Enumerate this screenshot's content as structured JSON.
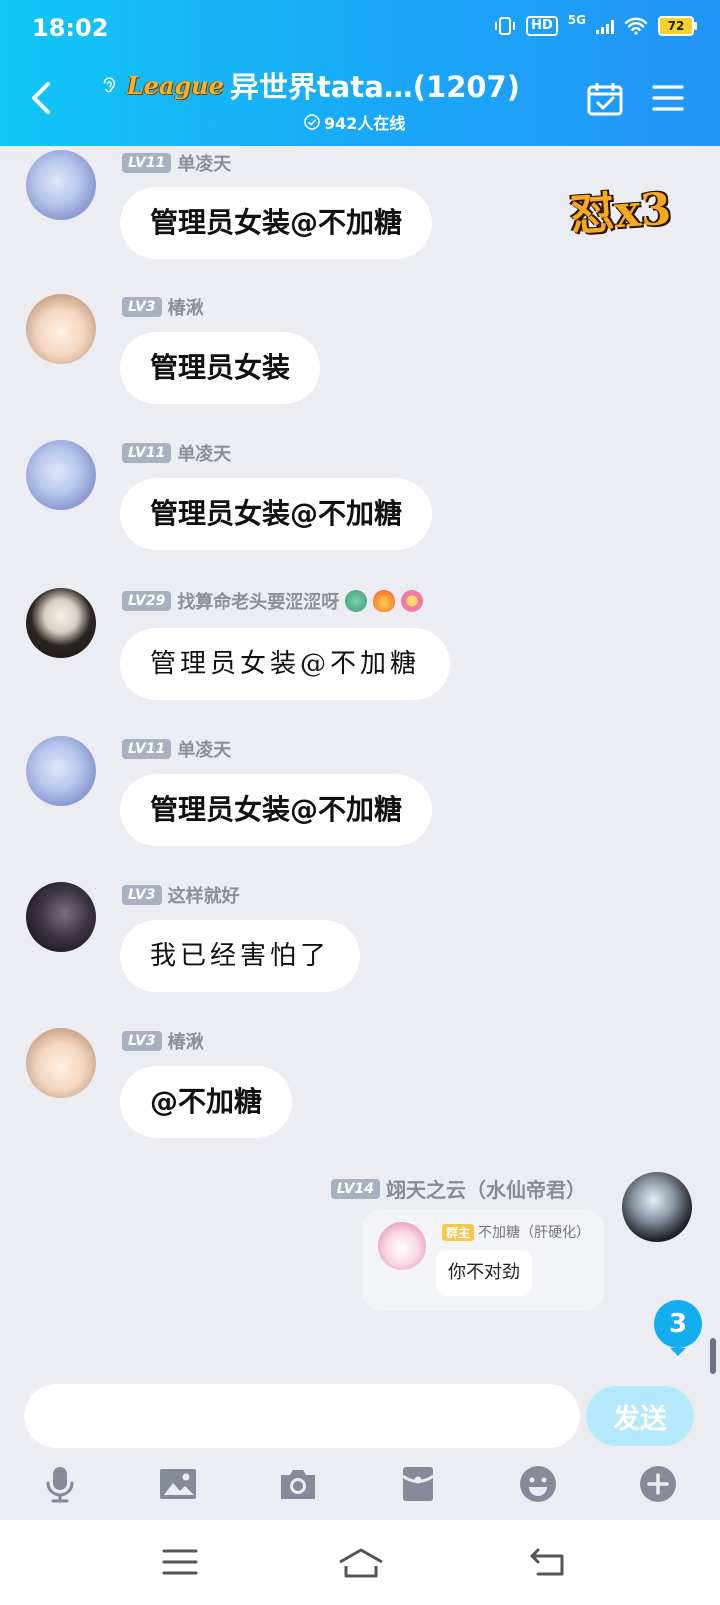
{
  "status": {
    "time": "18:02",
    "network": "5G",
    "hd": "HD",
    "battery": "72"
  },
  "header": {
    "logo": "League",
    "title": "异世界tata…(1207)",
    "online": "942人在线"
  },
  "messages": [
    {
      "level": "LV11",
      "name": "单凌天",
      "text": "管理员女装@不加糖",
      "sticker": "怼x3"
    },
    {
      "level": "LV3",
      "name": "椿湫",
      "text": "管理员女装"
    },
    {
      "level": "LV11",
      "name": "单凌天",
      "text": "管理员女装@不加糖"
    },
    {
      "level": "LV29",
      "name": "找算命老头要涩涩呀",
      "text": "管理员女装@不加糖"
    },
    {
      "level": "LV11",
      "name": "单凌天",
      "text": "管理员女装@不加糖"
    },
    {
      "level": "LV3",
      "name": "这样就好",
      "text": "我已经害怕了"
    },
    {
      "level": "LV3",
      "name": "椿湫",
      "text": "@不加糖"
    }
  ],
  "self_message": {
    "level": "LV14",
    "name": "翊天之云（水仙帝君）",
    "reply": {
      "badge": "群主",
      "name": "不加糖（肝硬化）",
      "text": "你不对劲"
    }
  },
  "unread_count": "3",
  "input": {
    "placeholder": "",
    "send_label": "发送"
  },
  "icons": [
    "microphone-icon",
    "image-icon",
    "camera-icon",
    "red-packet-icon",
    "emoji-icon",
    "plus-icon"
  ],
  "colors": {
    "header_start": "#12c6f6",
    "header_end": "#2295f6",
    "send_disabled": "#b5e8fb",
    "unread": "#12aef0"
  }
}
